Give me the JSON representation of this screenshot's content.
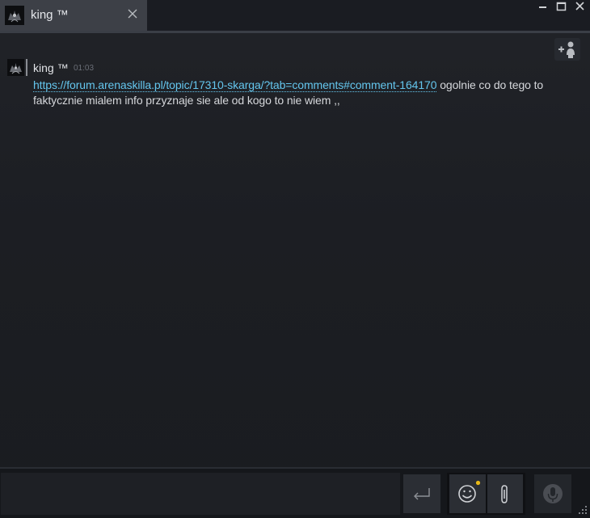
{
  "tab": {
    "title": "king ™"
  },
  "message": {
    "author": "king ™",
    "time": "01:03",
    "link": "https://forum.arenaskilla.pl/topic/17310-skarga/?tab=comments#comment-164170",
    "text": " ogolnie co do tego to faktycznie mialem info przyznaje sie ale od kogo to nie wiem ,,"
  },
  "input": {
    "value": ""
  },
  "icons": {
    "tab_avatar": "avatar-icon",
    "tab_close": "close-icon",
    "minimize": "minimize-icon",
    "maximize": "maximize-icon",
    "close_window": "close-icon",
    "add_friend": "add-friend-icon",
    "send": "enter-icon",
    "emoticon": "smiley-icon",
    "attach": "paperclip-icon",
    "voice": "microphone-icon",
    "resize": "resize-grip-icon"
  },
  "colors": {
    "link": "#64c6ee",
    "notification_dot": "#e8b816",
    "tab_active": "#3d4047",
    "background": "#1c1e23"
  }
}
